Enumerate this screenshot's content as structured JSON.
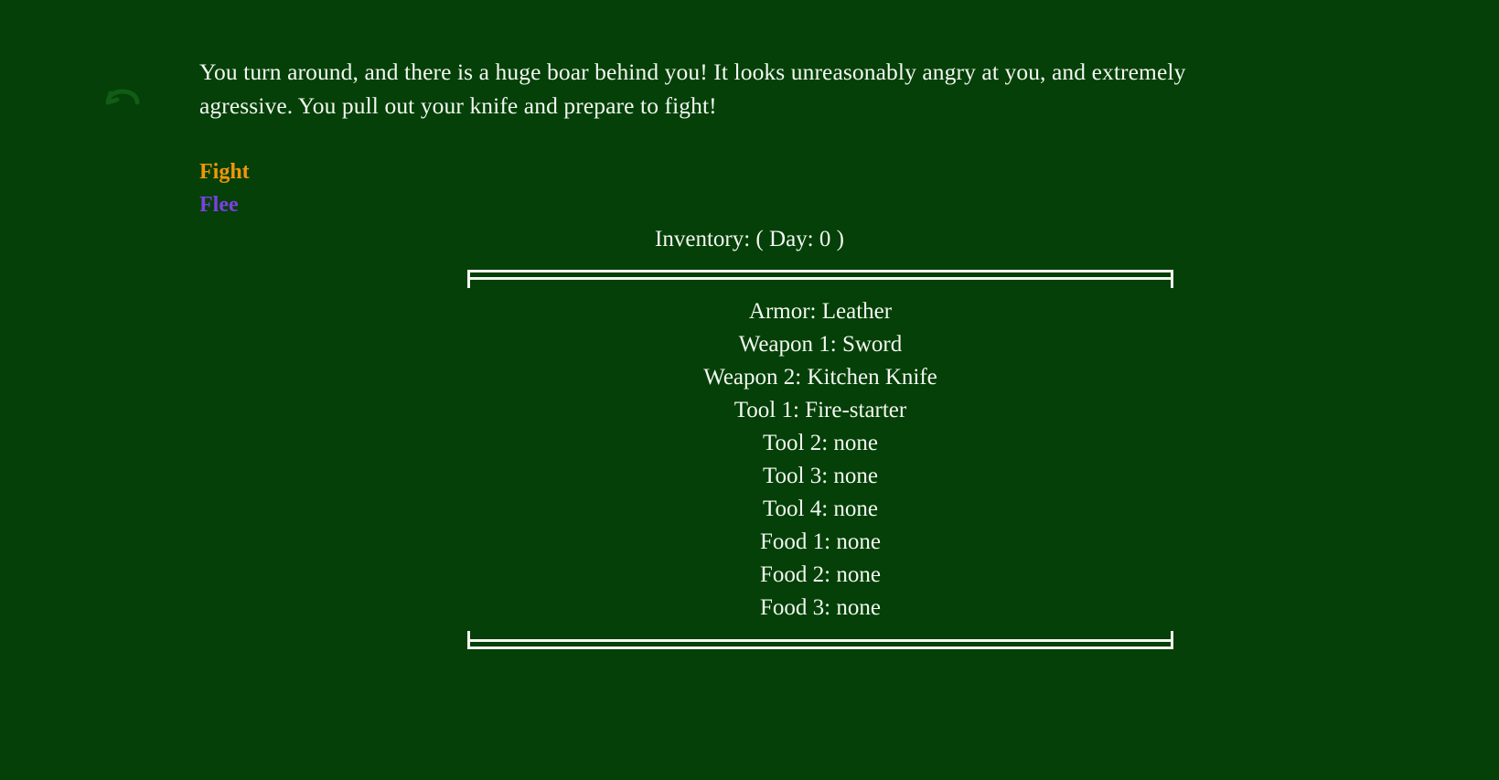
{
  "theme": {
    "background": "#044007",
    "text": "#f4f8f2",
    "fight_color": "#f2960a",
    "flee_color": "#7c3fe4",
    "arrow_color": "#115c16",
    "border_color": "#f2f7f0"
  },
  "nav": {
    "back_icon": "undo-arrow-icon"
  },
  "story": {
    "text": "You turn around, and there is a huge boar behind you! It looks unreasonably angry at you, and extremely agressive. You pull out your knife and prepare to fight!"
  },
  "choices": [
    {
      "label": "Fight",
      "name": "choice-fight"
    },
    {
      "label": "Flee",
      "name": "choice-flee"
    }
  ],
  "inventory": {
    "title": "Inventory: ( Day: 0 )",
    "day": 0,
    "items": [
      {
        "slot": "Armor",
        "value": "Leather",
        "text": "Armor: Leather"
      },
      {
        "slot": "Weapon 1",
        "value": "Sword",
        "text": "Weapon 1: Sword"
      },
      {
        "slot": "Weapon 2",
        "value": "Kitchen Knife",
        "text": "Weapon 2: Kitchen Knife"
      },
      {
        "slot": "Tool 1",
        "value": "Fire-starter",
        "text": "Tool 1: Fire-starter"
      },
      {
        "slot": "Tool 2",
        "value": "none",
        "text": "Tool 2: none"
      },
      {
        "slot": "Tool 3",
        "value": "none",
        "text": "Tool 3: none"
      },
      {
        "slot": "Tool 4",
        "value": "none",
        "text": "Tool 4: none"
      },
      {
        "slot": "Food 1",
        "value": "none",
        "text": "Food 1: none"
      },
      {
        "slot": "Food 2",
        "value": "none",
        "text": "Food 2: none"
      },
      {
        "slot": "Food 3",
        "value": "none",
        "text": "Food 3: none"
      }
    ]
  }
}
